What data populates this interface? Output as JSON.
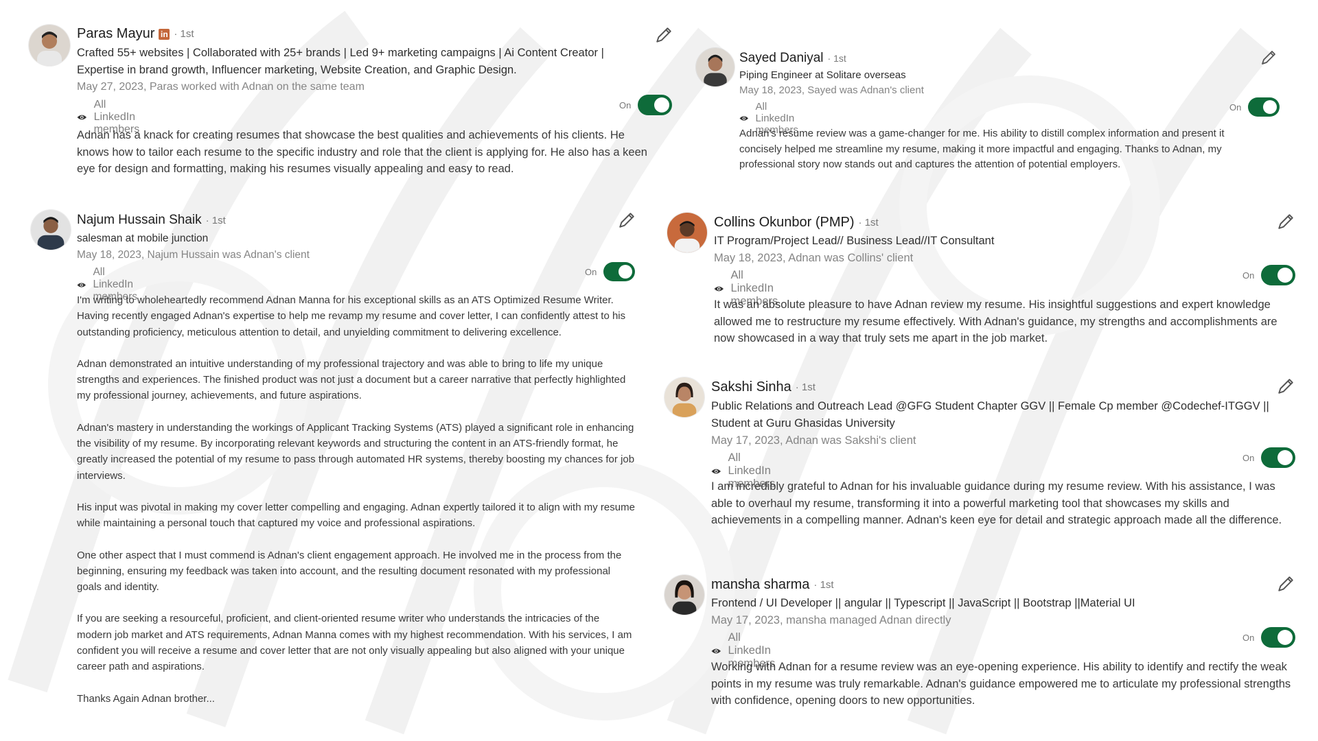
{
  "visibility_label": "All LinkedIn members",
  "toggle_label": "On",
  "cards": [
    {
      "name": "Paras Mayur",
      "degree": "· 1st",
      "headline_lines": [
        "Crafted 55+ websites | Collaborated with 25+ brands | Led 9+ marketing campaigns | Ai Content Creator |",
        "Expertise in brand growth, Influencer marketing, Website Creation, and Graphic Design."
      ],
      "date": "May 27, 2023, Paras worked with Adnan on the same team",
      "body": [
        "Adnan has a knack for creating resumes that showcase the best qualities and achievements of his clients. He knows how to tailor each resume to the specific industry and role that the client is applying for. He also has a keen eye for design and formatting, making his resumes visually appealing and easy to read."
      ]
    },
    {
      "name": "Sayed Daniyal",
      "degree": "· 1st",
      "headline_lines": [
        "Piping Engineer at Solitare overseas"
      ],
      "date": "May 18, 2023, Sayed was Adnan's client",
      "body": [
        "Adnan's resume review was a game-changer for me. His ability to distill complex information and present it concisely helped me streamline my resume, making it more impactful and engaging. Thanks to Adnan, my professional story now stands out and captures the attention of potential employers."
      ]
    },
    {
      "name": "Najum Hussain Shaik",
      "degree": "· 1st",
      "headline_lines": [
        "salesman at mobile junction"
      ],
      "date": "May 18, 2023, Najum Hussain was Adnan's client",
      "body": [
        "I'm writing to wholeheartedly recommend Adnan Manna for his exceptional skills as an ATS Optimized Resume Writer. Having recently engaged Adnan's expertise to help me revamp my resume and cover letter, I can confidently attest to his outstanding proficiency, meticulous attention to detail, and unyielding commitment to delivering excellence.",
        "Adnan demonstrated an intuitive understanding of my professional trajectory and was able to bring to life my unique strengths and experiences. The finished product was not just a document but a career narrative that perfectly highlighted my professional journey, achievements, and future aspirations.",
        "Adnan's mastery in understanding the workings of Applicant Tracking Systems (ATS) played a significant role in enhancing the visibility of my resume. By incorporating relevant keywords and structuring the content in an ATS-friendly format, he greatly increased the potential of my resume to pass through automated HR systems, thereby boosting my chances for job interviews.",
        "His input was pivotal in making my cover letter compelling and engaging. Adnan expertly tailored it to align with my resume while maintaining a personal touch that captured my voice and professional aspirations.",
        "One other aspect that I must commend is Adnan's client engagement approach. He involved me in the process from the beginning, ensuring my feedback was taken into account, and the resulting document resonated with my professional goals and identity.",
        "If you are seeking a resourceful, proficient, and client-oriented resume writer who understands the intricacies of the modern job market and ATS requirements, Adnan Manna comes with my highest recommendation. With his services, I am confident you will receive a resume and cover letter that are not only visually appealing but also aligned with your unique career path and aspirations.",
        "Thanks Again Adnan brother..."
      ]
    },
    {
      "name": "Collins Okunbor (PMP)",
      "degree": "· 1st",
      "headline_lines": [
        "IT Program/Project Lead// Business Lead//IT Consultant"
      ],
      "date": "May 18, 2023, Adnan was Collins' client",
      "body": [
        "It was an absolute pleasure to have Adnan review my resume. His insightful suggestions and expert knowledge allowed me to restructure my resume effectively. With Adnan's guidance, my strengths and accomplishments are now showcased in a way that truly sets me apart in the job market."
      ]
    },
    {
      "name": "Sakshi Sinha",
      "degree": "· 1st",
      "headline_lines": [
        "Public Relations and Outreach Lead @GFG Student Chapter GGV || Female Cp member @Codechef-ITGGV ||",
        "Student at Guru Ghasidas University"
      ],
      "date": "May 17, 2023, Adnan was Sakshi's client",
      "body": [
        "I am incredibly grateful to Adnan for his invaluable guidance during my resume review. With his assistance, I was able to overhaul my resume, transforming it into a powerful marketing tool that showcases my skills and achievements in a compelling manner. Adnan's keen eye for detail and strategic approach made all the difference."
      ]
    },
    {
      "name": "mansha sharma",
      "degree": "· 1st",
      "headline_lines": [
        "Frontend / UI Developer || angular || Typescript || JavaScript || Bootstrap ||Material UI"
      ],
      "date": "May 17, 2023, mansha managed Adnan directly",
      "body": [
        "Working with Adnan for a resume review was an eye-opening experience. His ability to identify and rectify the weak points in my resume was truly remarkable. Adnan's guidance empowered me to articulate my professional strengths with confidence, opening doors to new opportunities."
      ]
    }
  ]
}
